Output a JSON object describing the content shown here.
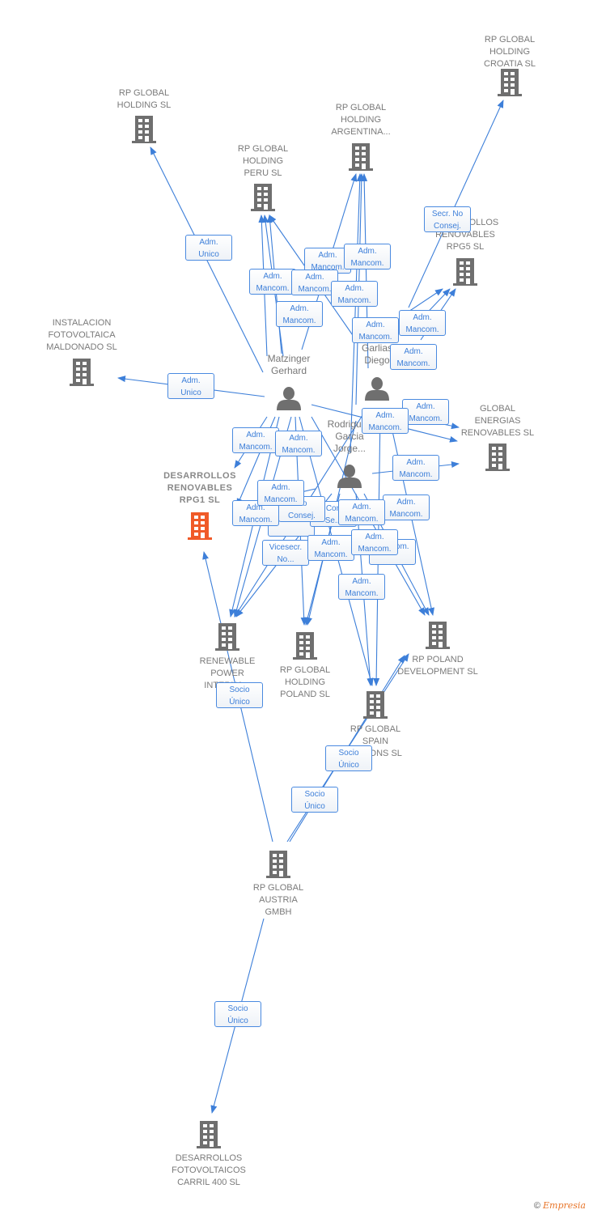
{
  "colors": {
    "edge": "#3d7fd9",
    "building": "#6f6f6f",
    "highlight": "#f05a28",
    "person": "#6f6f6f"
  },
  "companies": [
    {
      "id": "croatia",
      "label": "RP GLOBAL\nHOLDING\nCROATIA SL",
      "icon": "building-icon"
    },
    {
      "id": "holding",
      "label": "RP GLOBAL\nHOLDING SL",
      "icon": "building-icon"
    },
    {
      "id": "argentina",
      "label": "RP GLOBAL\nHOLDING\nARGENTINA...",
      "icon": "building-icon"
    },
    {
      "id": "peru",
      "label": "RP GLOBAL\nHOLDING\nPERU  SL",
      "icon": "building-icon"
    },
    {
      "id": "rpg5",
      "label": "DESARROLLOS\nRENOVABLES\nRPG5  SL",
      "icon": "building-icon"
    },
    {
      "id": "maldonado",
      "label": "INSTALACION\nFOTOVOLTAICA\nMALDONADO SL",
      "icon": "building-icon"
    },
    {
      "id": "energias",
      "label": "GLOBAL\nENERGIAS\nRENOVABLES SL",
      "icon": "building-icon"
    },
    {
      "id": "rpg1",
      "label": "DESARROLLOS\nRENOVABLES\nRPG1  SL",
      "icon": "building-icon",
      "highlighted": true
    },
    {
      "id": "renewable",
      "label": "RENEWABLE\nPOWER\nINTERNA...",
      "icon": "building-icon"
    },
    {
      "id": "poland",
      "label": "RP GLOBAL\nHOLDING\nPOLAND SL",
      "icon": "building-icon"
    },
    {
      "id": "polanddev",
      "label": "RP POLAND\nDEVELOPMENT SL",
      "icon": "building-icon"
    },
    {
      "id": "spain",
      "label": "RP GLOBAL\nSPAIN\n...ATIONS SL",
      "icon": "building-icon"
    },
    {
      "id": "austria",
      "label": "RP GLOBAL\nAUSTRIA\nGMBH",
      "icon": "building-icon"
    },
    {
      "id": "carril",
      "label": "DESARROLLOS\nFOTOVOLTAICOS\nCARRIL 400  SL",
      "icon": "building-icon"
    }
  ],
  "persons": [
    {
      "id": "matzinger",
      "label": "Matzinger\nGerhard",
      "icon": "person-icon"
    },
    {
      "id": "garlias",
      "label": "Garlias\nDiego",
      "icon": "person-icon"
    },
    {
      "id": "rodriguez",
      "label": "Rodriguez\nGarcia\nJorge...",
      "icon": "person-icon"
    }
  ],
  "edge_labels": [
    "Adm.\nUnico",
    "Adm.\nUnico",
    "Secr.  No\nConsej.",
    "Adm.\nMancom.",
    "Adm.\nMancom.",
    "Adm.\nMancom.",
    "Adm.\nMancom.",
    "Adm.\nMancom.",
    "Adm.\nMancom.",
    "Adm.\nMancom.",
    "Adm.\nMancom.",
    "Adm.\nMancom.",
    "Adm.\nMancom.",
    "Adm.\nMancom.",
    "Adm.\nMancom.",
    "Adm.\nMancom.",
    "Adm.\nMancom.",
    "Consej....",
    "Con\nSe...",
    "Adm.\nMancom.",
    "No\nConsej.",
    "Adm.\nMancom.",
    "Adm.\nMancom.",
    "Adm.\nMancom.",
    "Mancom.",
    "Vicesecr.\nNo...",
    "Adm.\nMancom.",
    "Adm.\nMancom.",
    "Adm.\nMancom.",
    "Socio\nÚnico",
    "Socio\nÚnico",
    "Socio\nÚnico",
    "Socio\nÚnico"
  ],
  "footer": {
    "copyright": "©",
    "brand": "Empresia"
  }
}
